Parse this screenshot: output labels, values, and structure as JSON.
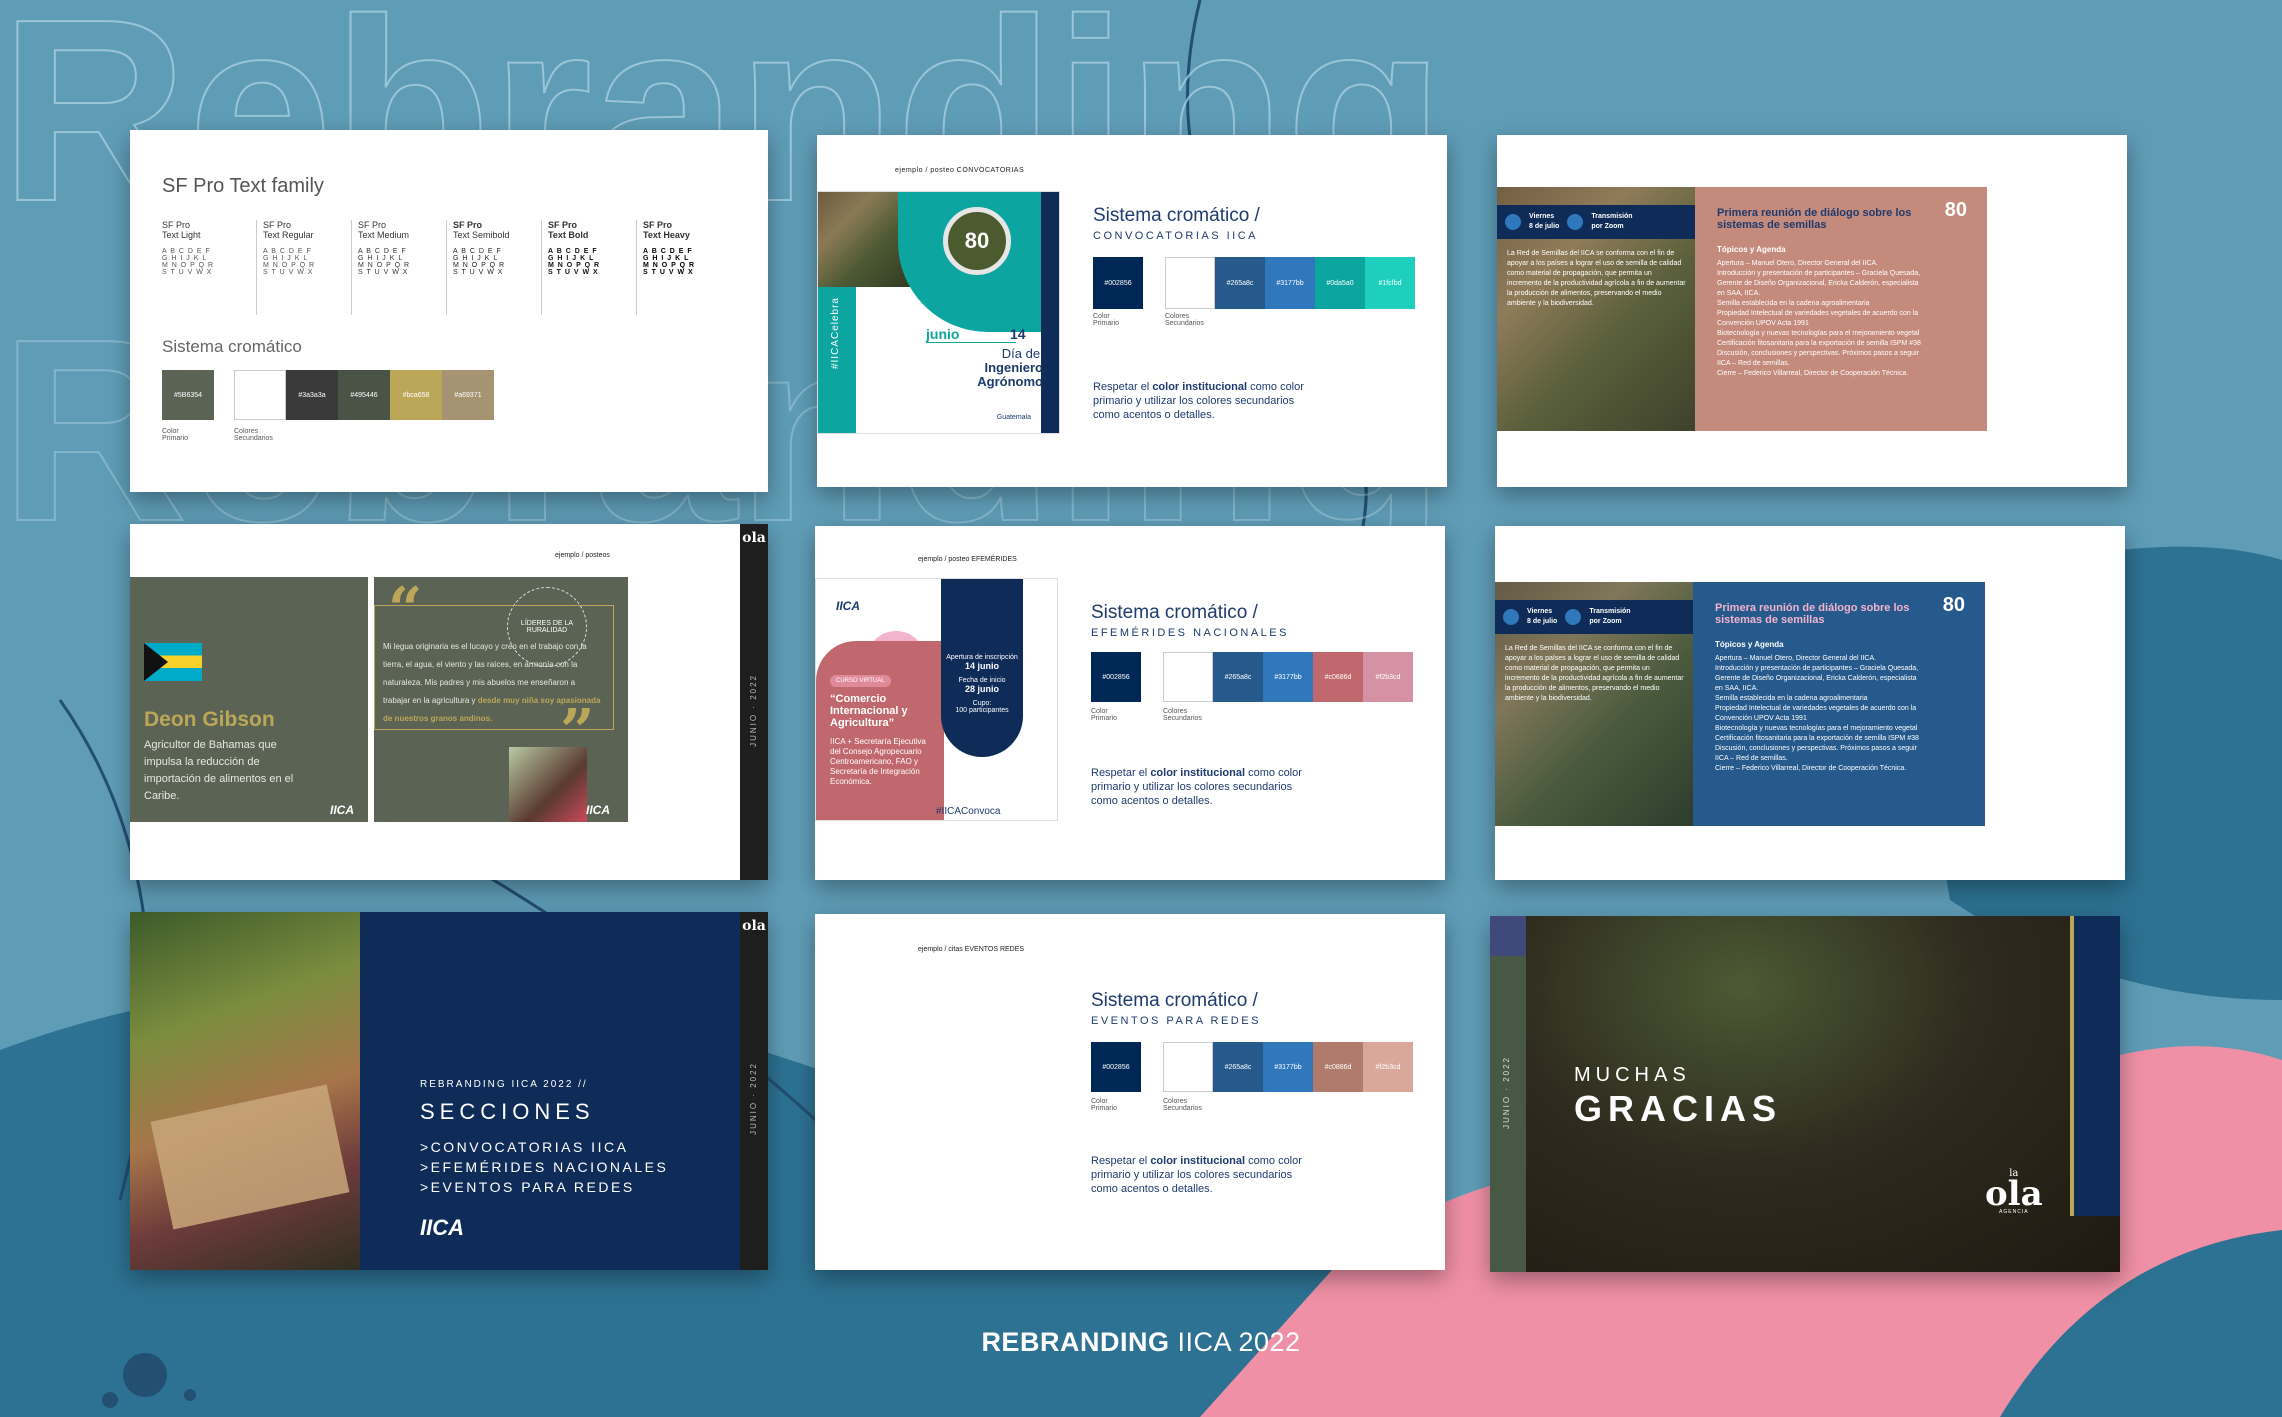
{
  "background": {
    "watermark": "Rebranding",
    "color": "#5f9db7",
    "footer_title_bold": "REBRANDING",
    "footer_title_light": "IICA 2022"
  },
  "colors": {
    "primary": "#002856",
    "teal": "#0da5a0",
    "pink": "#f090a6",
    "dark_blue": "#0f2b57"
  },
  "slide_typography": {
    "title": "SF Pro Text family",
    "fonts": [
      {
        "label": "SF Pro\nText Light",
        "line1": "SF Pro",
        "line2": "Text Light"
      },
      {
        "line1": "SF Pro",
        "line2": "Text Regular"
      },
      {
        "line1": "SF Pro",
        "line2": "Text Medium"
      },
      {
        "line1": "SF Pro",
        "line2": "Text Semibold"
      },
      {
        "line1": "SF Pro",
        "line2": "Text Bold"
      },
      {
        "line1": "SF Pro",
        "line2": "Text Heavy"
      }
    ],
    "alphabet": [
      "A B C D E F",
      "G H I J K L",
      "M N O P Q R",
      "S T U V W X"
    ],
    "color_title": "Sistema cromático",
    "swatches": [
      {
        "label": "#5B6354",
        "color": "#5b6354"
      },
      {
        "label": "",
        "color": "#ffffff"
      },
      {
        "label": "#3a3a3a",
        "color": "#3a3a3a"
      },
      {
        "label": "#495446",
        "color": "#495446"
      },
      {
        "label": "#bca658",
        "color": "#bca658"
      },
      {
        "label": "#a69371",
        "color": "#a69371"
      }
    ],
    "primary_label": "Color\nPrimario",
    "secondary_label": "Colores\nSecundarios"
  },
  "slide_convocatorias": {
    "header": "ejemplo / posteo CONVOCATORIAS",
    "system_title": "Sistema cromático /",
    "system_sub": "CONVOCATORIAS IICA",
    "post_month": "junio",
    "post_day": "14",
    "post_line1": "Día del",
    "post_line2": "Ingeniero",
    "post_line3": "Agrónomo",
    "post_place": "Guatemala",
    "post_hashtag": "#IICACelebra",
    "badge": "80",
    "swatches": [
      {
        "label": "#002856",
        "color": "#002856"
      },
      {
        "label": "",
        "color": "#ffffff"
      },
      {
        "label": "#265a8c",
        "color": "#265a8c"
      },
      {
        "label": "#3177bb",
        "color": "#3177bb"
      },
      {
        "label": "#0da5a0",
        "color": "#0da5a0"
      },
      {
        "label": "#1fcfbd",
        "color": "#1fcfbd"
      }
    ],
    "primary_label": "Color\nPrimario",
    "secondary_label": "Colores\nSecundarios",
    "note_pre": "Respetar el ",
    "note_bold": "color institucional",
    "note_post": "como color primario y utilizar los colores secundarios como acentos o detalles."
  },
  "slide_agenda_pink": {
    "day": "Viernes\n8 de julio",
    "stream": "Transmisión\npor Zoom",
    "title": "Primera reunión de diálogo sobre los sistemas de semillas",
    "agenda_heading": "Tópicos y Agenda",
    "body": "La Red de Semillas del IICA se conforma con el fin de apoyar a los países a lograr el uso de semilla de calidad como material de propagación, que permita un incremento de la productividad agrícola a fin de aumentar la producción de alimentos, preservando el medio ambiente y la biodiversidad.",
    "items": [
      "Apertura – Manuel Otero, Director General del IICA.",
      "Introducción y presentación de participantes – Graciela Quesada, Gerente de Diseño Organizacional, Ericka Calderón, especialista en SAA, IICA.",
      "Semilla establecida en la cadena agroalimentaria",
      "Propiedad Intelectual de variedades vegetales de acuerdo con la Convención UPOV Acta 1991",
      "Biotecnología y nuevas tecnologías para el mejoramiento vegetal",
      "Certificación fitosanitaria para la exportación de semilla ISPM #38",
      "Discusión, conclusiones y perspectivas. Próximos pasos a seguir IICA – Red de semillas.",
      "Cierre – Federico Villarreal, Director de Cooperación Técnica."
    ],
    "badge": "80"
  },
  "slide_lideres": {
    "header": "ejemplo / posteos",
    "name": "Deon Gibson",
    "desc": "Agricultor de Bahamas que impulsa la reducción de importación de alimentos en el Caribe.",
    "circle": "LÍDERES DE LA RURALIDAD",
    "quote_plain": "Mi legua originaria es el lucayo y creo en el trabajo con la tierra, el agua, el viento y las raíces, en armonía con la naturaleza. Mis padres y mis abuelos me enseñaron a trabajar en la agricultura y ",
    "quote_bold": "desde muy niña soy apasionada de nuestros granos andinos.",
    "logo": "IICA",
    "side_logo": "ola",
    "side_text": "JUNIO · 2022"
  },
  "slide_efemerides": {
    "header": "ejemplo / posteo EFEMÉRIDES",
    "system_title": "Sistema cromático /",
    "system_sub": "EFEMÉRIDES NACIONALES",
    "logo": "IICA",
    "tag": "CURSO VIRTUAL",
    "post_title": "“Comercio Internacional y Agricultura”",
    "post_body": "IICA + Secretaría Ejecutiva del Consejo Agropecuario Centroamericano, FAO y Secretaría de Integración Económica.",
    "post_hashtag": "#IICAConvoca",
    "open_label": "Apertura de inscripción",
    "open_date": "14 junio",
    "start_label": "Fecha de inicio",
    "start_date": "28 junio",
    "quota": "Cupo:\n100 participantes",
    "swatches": [
      {
        "label": "#002856",
        "color": "#002856"
      },
      {
        "label": "",
        "color": "#ffffff"
      },
      {
        "label": "#265a8c",
        "color": "#265a8c"
      },
      {
        "label": "#3177bb",
        "color": "#3177bb"
      },
      {
        "label": "#c0686d",
        "color": "#c0686d"
      },
      {
        "label": "#f2b3cd",
        "color": "#d592a5"
      }
    ],
    "primary_label": "Color\nPrimario",
    "secondary_label": "Colores\nSecundarios",
    "note_pre": "Respetar el ",
    "note_bold": "color institucional",
    "note_post": "como color primario y utilizar los colores secundarios como acentos o detalles."
  },
  "slide_agenda_blue": {
    "day": "Viernes\n8 de julio",
    "stream": "Transmisión\npor Zoom",
    "title": "Primera reunión de diálogo sobre los sistemas de semillas",
    "agenda_heading": "Tópicos y Agenda",
    "body": "La Red de Semillas del IICA se conforma con el fin de apoyar a los países a lograr el uso de semilla de calidad como material de propagación, que permita un incremento de la productividad agrícola a fin de aumentar la producción de alimentos, preservando el medio ambiente y la biodiversidad.",
    "items": [
      "Apertura – Manuel Otero, Director General del IICA.",
      "Introducción y presentación de participantes – Graciela Quesada, Gerente de Diseño Organizacional, Ericka Calderón, especialista en SAA, IICA.",
      "Semilla establecida en la cadena agroalimentaria",
      "Propiedad Intelectual de variedades vegetales de acuerdo con la Convención UPOV Acta 1991",
      "Biotecnología y nuevas tecnologías para el mejoramiento vegetal",
      "Certificación fitosanitaria para la exportación de semilla ISPM #38",
      "Discusión, conclusiones y perspectivas. Próximos pasos a seguir IICA – Red de semillas.",
      "Cierre – Federico Villarreal, Director de Cooperación Técnica."
    ],
    "badge": "80"
  },
  "slide_secciones": {
    "kicker": "REBRANDING IICA 2022 //",
    "title": "SECCIONES",
    "items": [
      ">CONVOCATORIAS IICA",
      ">EFEMÉRIDES NACIONALES",
      ">EVENTOS PARA REDES"
    ],
    "logo": "IICA",
    "side_logo": "ola",
    "side_text": "JUNIO · 2022"
  },
  "slide_eventos": {
    "header": "ejemplo / citas EVENTOS REDES",
    "system_title": "Sistema cromático /",
    "system_sub": "EVENTOS PARA REDES",
    "swatches": [
      {
        "label": "#002856",
        "color": "#002856"
      },
      {
        "label": "",
        "color": "#ffffff"
      },
      {
        "label": "#265a8c",
        "color": "#265a8c"
      },
      {
        "label": "#3177bb",
        "color": "#3177bb"
      },
      {
        "label": "#c0886d",
        "color": "#b07b6a"
      },
      {
        "label": "#f2b3cd",
        "color": "#d9a89a"
      }
    ],
    "primary_label": "Color\nPrimario",
    "secondary_label": "Colores\nSecundarios",
    "note_pre": "Respetar el ",
    "note_bold": "color institucional",
    "note_post": "como color primario y utilizar los colores secundarios como acentos o detalles."
  },
  "slide_gracias": {
    "line1": "MUCHAS",
    "line2": "GRACIAS",
    "side_text": "JUNIO · 2022",
    "logo": "ola",
    "logo_sub": "AGENCIA",
    "logo_top": "la"
  }
}
